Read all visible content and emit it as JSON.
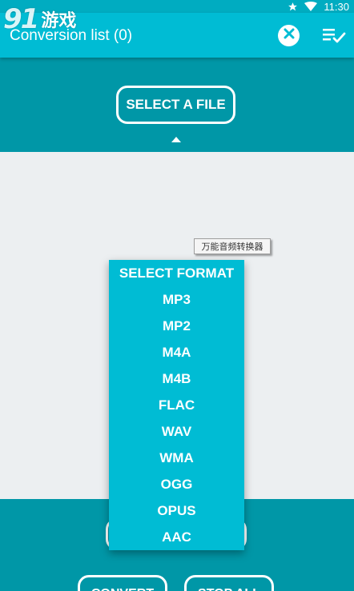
{
  "status_bar": {
    "time": "11:30",
    "icons": [
      "star-icon",
      "wifi-icon"
    ]
  },
  "watermark": {
    "logo_text": "91",
    "brand_text": "游戏"
  },
  "app_bar": {
    "title": "Conversion list (0)",
    "actions": [
      "clear-icon",
      "queue-list-icon"
    ]
  },
  "select_area": {
    "select_file_label": "SELECT A FILE"
  },
  "tooltip": {
    "text": "万能音频转换器"
  },
  "format_menu": {
    "header": "SELECT FORMAT",
    "options": [
      "MP3",
      "MP2",
      "M4A",
      "M4B",
      "FLAC",
      "WAV",
      "WMA",
      "OGG",
      "OPUS",
      "AAC"
    ]
  },
  "bottom_bar": {
    "format_button_label": "",
    "convert_label": "CONVERT",
    "stop_all_label": "STOP ALL"
  },
  "colors": {
    "app_bar": "#00bcd4",
    "status_bar": "#00acc1",
    "panel": "#0097a7",
    "background": "#eceff1",
    "menu": "#00bcd4"
  }
}
